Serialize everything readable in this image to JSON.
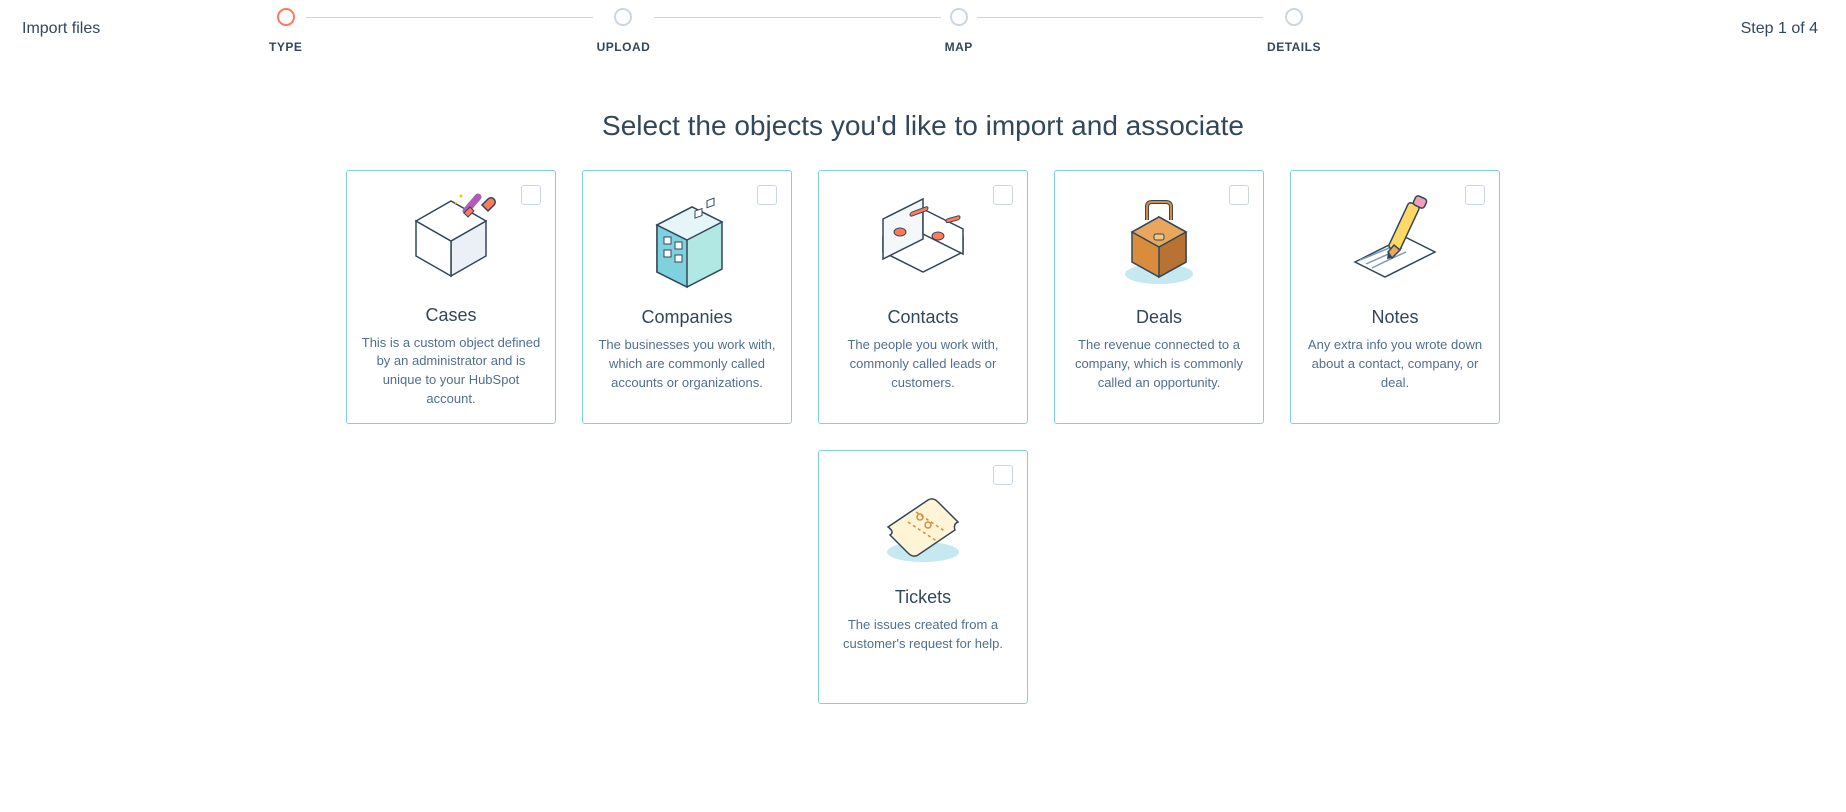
{
  "page_title": "Import files",
  "step_indicator": "Step 1 of 4",
  "stepper": [
    {
      "label": "TYPE",
      "active": true
    },
    {
      "label": "UPLOAD",
      "active": false
    },
    {
      "label": "MAP",
      "active": false
    },
    {
      "label": "DETAILS",
      "active": false
    }
  ],
  "heading": "Select the objects you'd like to import and associate",
  "cards": [
    {
      "title": "Cases",
      "desc": "This is a custom object defined by an administrator and is unique to your HubSpot account.",
      "icon": "cases-icon"
    },
    {
      "title": "Companies",
      "desc": "The businesses you work with, which are commonly called accounts or organizations.",
      "icon": "companies-icon"
    },
    {
      "title": "Contacts",
      "desc": "The people you work with, commonly called leads or customers.",
      "icon": "contacts-icon"
    },
    {
      "title": "Deals",
      "desc": "The revenue connected to a company, which is commonly called an opportunity.",
      "icon": "deals-icon"
    },
    {
      "title": "Notes",
      "desc": "Any extra info you wrote down about a contact, company, or deal.",
      "icon": "notes-icon"
    },
    {
      "title": "Tickets",
      "desc": "The issues created from a customer's request for help.",
      "icon": "tickets-icon"
    }
  ]
}
